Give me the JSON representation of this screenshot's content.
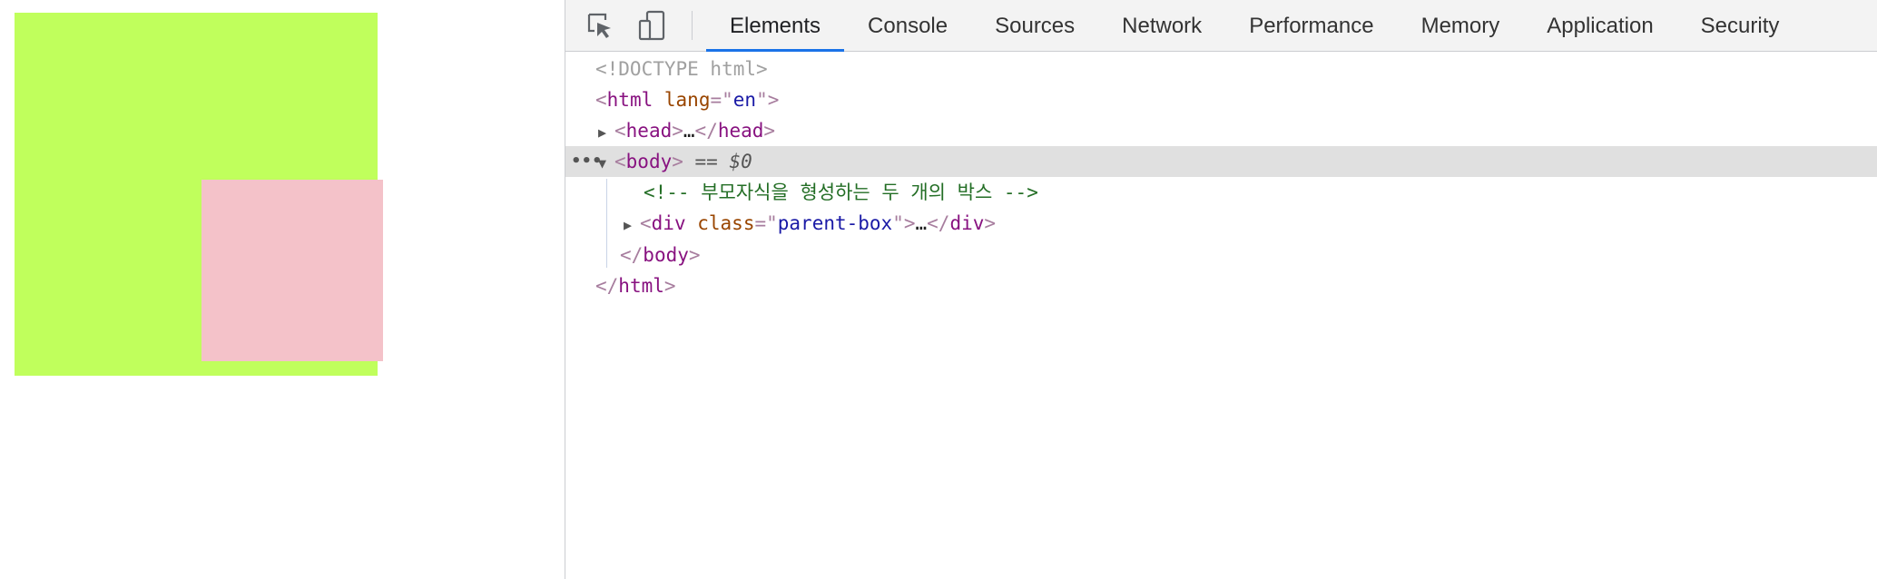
{
  "preview": {
    "parent_color": "#c0ff5c",
    "child_color": "#f4c2c9"
  },
  "toolbar": {
    "inspect_icon": "inspect-cursor-icon",
    "device_icon": "device-toolbar-icon",
    "tabs": [
      {
        "label": "Elements",
        "active": true
      },
      {
        "label": "Console"
      },
      {
        "label": "Sources"
      },
      {
        "label": "Network"
      },
      {
        "label": "Performance"
      },
      {
        "label": "Memory"
      },
      {
        "label": "Application"
      },
      {
        "label": "Security"
      }
    ]
  },
  "dom": {
    "doctype": "<!DOCTYPE html>",
    "html_open": {
      "lt": "<",
      "tag": "html",
      "attr": "lang",
      "eq": "=\"",
      "val": "en",
      "close": "\">"
    },
    "head": {
      "lt": "<",
      "tag": "head",
      "gt": ">",
      "ellipsis": "…",
      "close_lt": "</",
      "close_gt": ">"
    },
    "body_open": {
      "lt": "<",
      "tag": "body",
      "gt": ">",
      "eq": " == ",
      "ref": "$0"
    },
    "comment": "<!-- 부모자식을 형성하는 두 개의 박스 -->",
    "div": {
      "lt": "<",
      "tag": "div",
      "attr": "class",
      "eq": "=\"",
      "val": "parent-box",
      "close": "\">",
      "ellipsis": "…",
      "close_lt": "</",
      "close_gt": ">"
    },
    "body_close": {
      "lt": "</",
      "tag": "body",
      "gt": ">"
    },
    "html_close": {
      "lt": "</",
      "tag": "html",
      "gt": ">"
    },
    "dots": "•••"
  }
}
